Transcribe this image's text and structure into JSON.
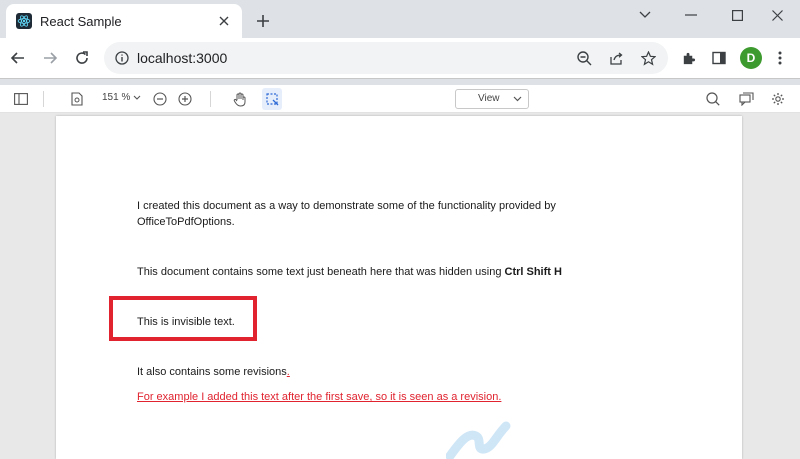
{
  "browser": {
    "tab": {
      "title": "React Sample",
      "icon": "react-icon"
    },
    "url": "localhost:3000",
    "profile_initial": "D",
    "colors": {
      "tab_strip": "#dee1e6",
      "avatar": "#3c9a2e"
    }
  },
  "pdf_toolbar": {
    "zoom": "151 %",
    "view_label": "View"
  },
  "document": {
    "line1a": "I created this document as a way to demonstrate some of the functionality provided by",
    "line1b": "OfficeToPdfOptions.",
    "line2_text": "This document contains some text just beneath here that was hidden using ",
    "line2_bold": "Ctrl Shift H",
    "hidden_text": "This is invisible text.",
    "line3": "It also contains some revisions",
    "line3_mark": ".",
    "revision_text": "For example I added this text after the first save, so it is seen as a revision.",
    "colors": {
      "revision": "#e0232f",
      "highlight_box": "#e0232f"
    }
  }
}
